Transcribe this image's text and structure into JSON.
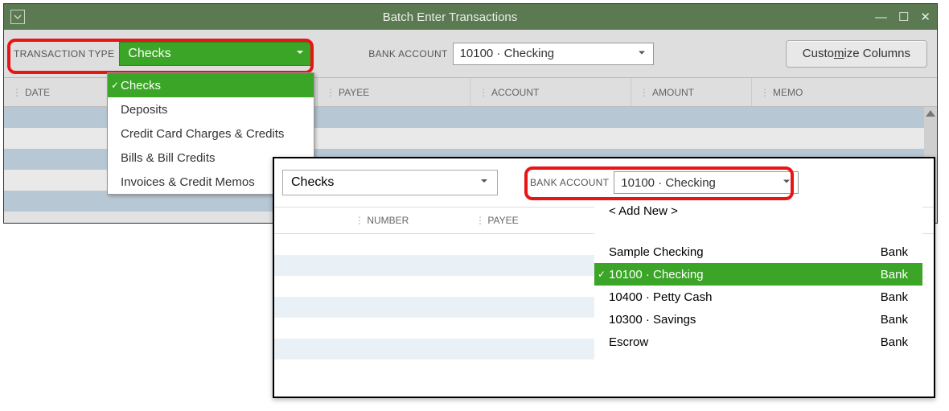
{
  "title": "Batch Enter Transactions",
  "toolbar": {
    "transaction_type_label": "TRANSACTION TYPE",
    "bank_account_label": "BANK ACCOUNT",
    "transaction_type_value": "Checks",
    "bank_account_value": "10100 · Checking",
    "customize_pre": "Custo",
    "customize_m": "m",
    "customize_post": "ize Columns"
  },
  "columns": {
    "date": "DATE",
    "number": "NUMBER",
    "payee": "PAYEE",
    "account": "ACCOUNT",
    "amount": "AMOUNT",
    "memo": "MEMO"
  },
  "type_menu": {
    "items": [
      "Checks",
      "Deposits",
      "Credit Card Charges & Credits",
      "Bills & Bill Credits",
      "Invoices & Credit Memos"
    ]
  },
  "fg": {
    "type_value": "Checks",
    "bank_account_label": "BANK ACCOUNT",
    "bank_account_value": "10100 · Checking",
    "col_number": "NUMBER",
    "col_payee": "PAYEE"
  },
  "acct_menu": {
    "add_new": "< Add New >",
    "items": [
      {
        "name": "Sample Checking",
        "type": "Bank"
      },
      {
        "name": "10100 · Checking",
        "type": "Bank"
      },
      {
        "name": "10400 · Petty Cash",
        "type": "Bank"
      },
      {
        "name": "10300 · Savings",
        "type": "Bank"
      },
      {
        "name": "Escrow",
        "type": "Bank"
      }
    ]
  }
}
